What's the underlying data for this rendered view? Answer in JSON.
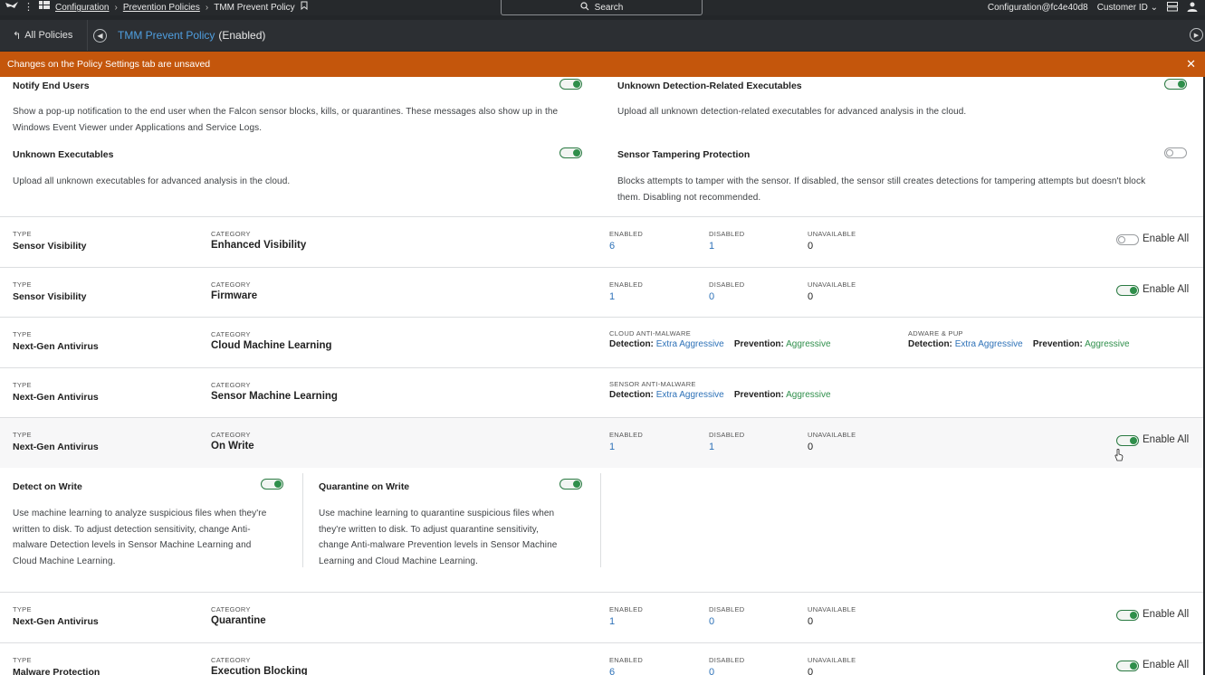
{
  "topbar": {
    "breadcrumbs": [
      "Configuration",
      "Prevention Policies",
      "TMM Prevent Policy"
    ],
    "search_label": "Search",
    "account": "Configuration@fc4e40d8",
    "customer_id_label": "Customer ID"
  },
  "policybar": {
    "back_label": "All Policies",
    "policy_name": "TMM Prevent Policy",
    "policy_status": "(Enabled)"
  },
  "banner": {
    "message": "Changes on the Policy Settings tab are unsaved"
  },
  "settings_top": {
    "notify": {
      "title": "Notify End Users",
      "desc1": "Show a pop-up notification to the end user when the Falcon sensor blocks, kills, or quarantines. These messages also show up in the",
      "desc2": "Windows Event Viewer under Applications and Service Logs.",
      "enabled": true
    },
    "unknown_detection": {
      "title": "Unknown Detection-Related Executables",
      "desc1": "Upload all unknown detection-related executables for advanced analysis in the cloud.",
      "enabled": true
    },
    "unknown_exec": {
      "title": "Unknown Executables",
      "desc1": "Upload all unknown executables for advanced analysis in the cloud.",
      "enabled": true
    },
    "tamper": {
      "title": "Sensor Tampering Protection",
      "desc1": "Blocks attempts to tamper with the sensor. If disabled, the sensor still creates detections for tampering attempts but doesn't block",
      "desc2": "them. Disabling not recommended.",
      "enabled": false
    }
  },
  "labels": {
    "type": "TYPE",
    "category": "CATEGORY",
    "enabled": "ENABLED",
    "disabled": "DISABLED",
    "unavailable": "UNAVAILABLE",
    "enable_all": "Enable All",
    "cloud_am": "CLOUD ANTI-MALWARE",
    "adware": "ADWARE & PUP",
    "sensor_am": "SENSOR ANTI-MALWARE",
    "detection": "Detection:",
    "prevention": "Prevention:"
  },
  "rows": [
    {
      "type": "Sensor Visibility",
      "category": "Enhanced Visibility",
      "enabled": "6",
      "disabled": "1",
      "unavailable": "0",
      "toggle": false
    },
    {
      "type": "Sensor Visibility",
      "category": "Firmware",
      "enabled": "1",
      "disabled": "0",
      "unavailable": "0",
      "toggle": true
    },
    {
      "type": "Next-Gen Antivirus",
      "category": "Cloud Machine Learning",
      "cloud_detection": "Extra Aggressive",
      "cloud_prevention": "Aggressive",
      "adware_detection": "Extra Aggressive",
      "adware_prevention": "Aggressive"
    },
    {
      "type": "Next-Gen Antivirus",
      "category": "Sensor Machine Learning",
      "sensor_detection": "Extra Aggressive",
      "sensor_prevention": "Aggressive"
    },
    {
      "type": "Next-Gen Antivirus",
      "category": "On Write",
      "enabled": "1",
      "disabled": "1",
      "unavailable": "0",
      "toggle": true
    },
    {
      "type": "Next-Gen Antivirus",
      "category": "Quarantine",
      "enabled": "1",
      "disabled": "0",
      "unavailable": "0",
      "toggle": true
    },
    {
      "type": "Malware Protection",
      "category": "Execution Blocking",
      "enabled": "6",
      "disabled": "0",
      "unavailable": "0",
      "toggle": true
    }
  ],
  "on_write": {
    "detect": {
      "title": "Detect on Write",
      "lines": [
        "Use machine learning to analyze suspicious files when they're",
        "written to disk. To adjust detection sensitivity, change Anti-",
        "malware Detection levels in Sensor Machine Learning and",
        "Cloud Machine Learning."
      ],
      "enabled": true
    },
    "quarantine": {
      "title": "Quarantine on Write",
      "lines": [
        "Use machine learning to quarantine suspicious files when",
        "they're written to disk. To adjust quarantine sensitivity,",
        "change Anti-malware Prevention levels in Sensor Machine",
        "Learning and Cloud Machine Learning."
      ],
      "enabled": true
    }
  },
  "colors": {
    "accent_blue": "#2e72b8",
    "toggle_green": "#2f8f4b",
    "banner_orange": "#c4560c"
  }
}
